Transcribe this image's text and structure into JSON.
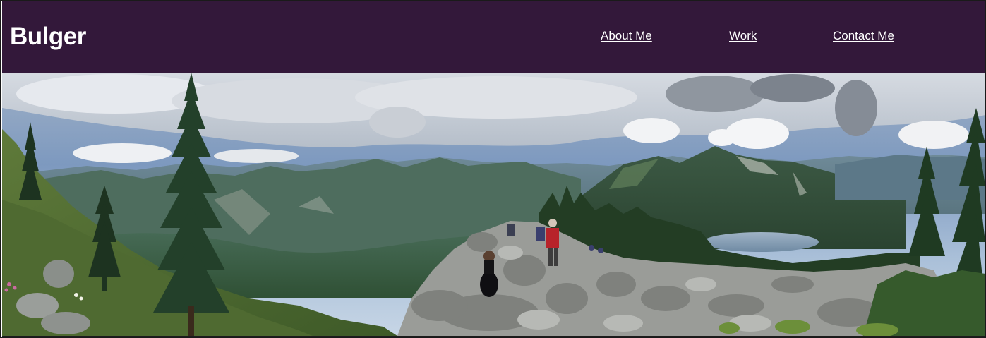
{
  "site": {
    "brand": "Bulger"
  },
  "nav": {
    "items": [
      {
        "label": "About Me"
      },
      {
        "label": "Work"
      },
      {
        "label": "Contact Me"
      }
    ]
  },
  "colors": {
    "header_bg": "#33183a",
    "header_text": "#ffffff"
  },
  "hero": {
    "icon": "panorama-mountain-photo"
  }
}
